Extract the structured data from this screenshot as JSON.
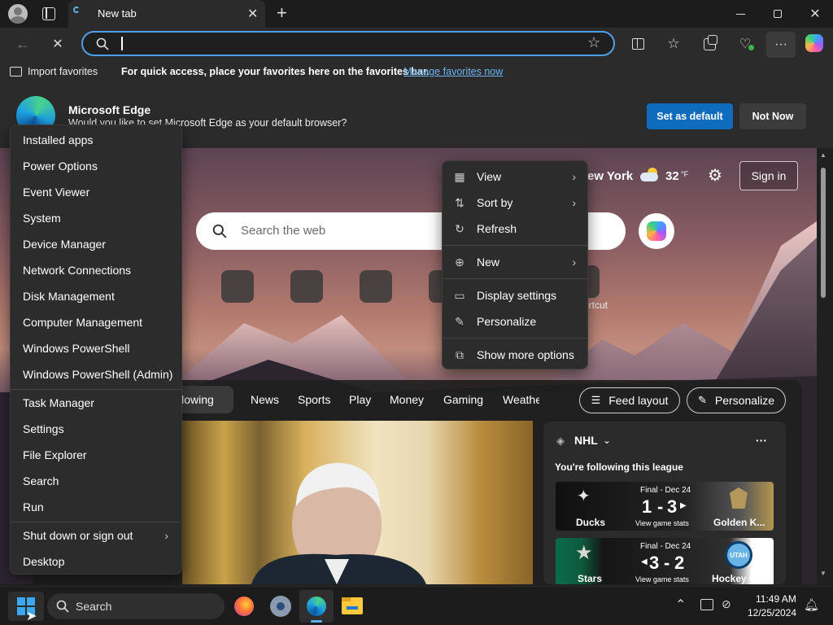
{
  "browser": {
    "tab_title": "New tab",
    "new_tab_symbol": "+",
    "window_controls": [
      "minimize-icon",
      "restore-icon",
      "close-icon"
    ]
  },
  "address_bar": {
    "value": "",
    "placeholder": ""
  },
  "favorites_bar": {
    "import_label": "Import favorites",
    "message": "For quick access, place your favorites here on the favorites bar.",
    "manage_link": "Manage favorites now"
  },
  "banner": {
    "title": "Microsoft Edge",
    "message": "Would you like to set Microsoft Edge as your default browser?",
    "set_default": "Set as default",
    "not_now": "Not Now"
  },
  "new_tab_page": {
    "weather_city": "ew York",
    "weather_temp": "32",
    "weather_unit": "°F",
    "sign_in": "Sign in",
    "search_placeholder": "Search the web",
    "shortcut_partial_label": "ortcut"
  },
  "feed": {
    "tabs": [
      "llowing",
      "News",
      "Sports",
      "Play",
      "Money",
      "Gaming",
      "Weathe"
    ],
    "feed_layout": "Feed layout",
    "personalize": "Personalize"
  },
  "nhl": {
    "league": "NHL",
    "following_text": "You're following this league",
    "more": "···",
    "games": [
      {
        "status": "Final - Dec 24",
        "home": "Ducks",
        "away": "Golden K...",
        "score_home": "1",
        "score_away": "3",
        "score_sep": "-",
        "stats": "View game stats"
      },
      {
        "status": "Final - Dec 24",
        "home": "Stars",
        "away": "Hockey Cl...",
        "score_home": "3",
        "score_away": "2",
        "score_sep": "-",
        "stats": "View game stats",
        "away_badge": "UTAH"
      }
    ]
  },
  "context_menu": {
    "items": [
      {
        "label": "View",
        "icon": "view-grid-icon",
        "submenu": true
      },
      {
        "label": "Sort by",
        "icon": "sort-icon",
        "submenu": true
      },
      {
        "label": "Refresh",
        "icon": "refresh-icon",
        "submenu": false
      },
      {
        "label": "New",
        "icon": "new-plus-icon",
        "submenu": true
      },
      {
        "label": "Display settings",
        "icon": "display-icon",
        "submenu": false
      },
      {
        "label": "Personalize",
        "icon": "pen-icon",
        "submenu": false
      },
      {
        "label": "Show more options",
        "icon": "more-options-icon",
        "submenu": false
      }
    ]
  },
  "winx_menu": {
    "items": [
      "Installed apps",
      "Power Options",
      "Event Viewer",
      "System",
      "Device Manager",
      "Network Connections",
      "Disk Management",
      "Computer Management",
      "Windows PowerShell",
      "Windows PowerShell (Admin)",
      "Task Manager",
      "Settings",
      "File Explorer",
      "Search",
      "Run",
      "Shut down or sign out",
      "Desktop"
    ]
  },
  "taskbar": {
    "search_label": "Search",
    "time": "11:49 AM",
    "date": "12/25/2024"
  }
}
